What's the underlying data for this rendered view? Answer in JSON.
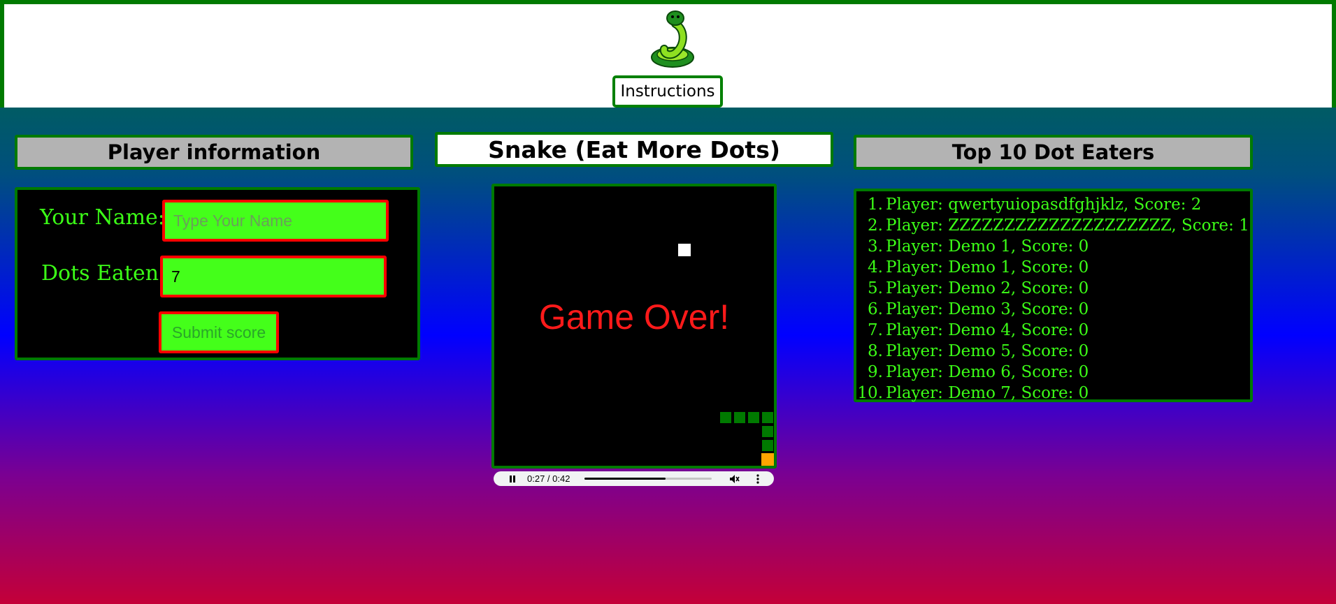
{
  "header": {
    "instructions_label": "Instructions"
  },
  "player_panel": {
    "title": "Player information",
    "name_label": "Your Name:",
    "name_value": "",
    "name_placeholder": "Type Your Name",
    "dots_label": "Dots Eaten:",
    "dots_value": "7",
    "submit_label": "Submit score"
  },
  "game_panel": {
    "title": "Snake (Eat More Dots)",
    "status_text": "Game Over!",
    "media": {
      "time": "0:27 / 0:42",
      "progress": 0.64
    }
  },
  "scores_panel": {
    "title": "Top 10 Dot Eaters",
    "entries": [
      {
        "rank": "1.",
        "text": "Player: qwertyuiopasdfghjklz, Score: 2"
      },
      {
        "rank": "2.",
        "text": "Player: ZZZZZZZZZZZZZZZZZZZZ, Score: 1"
      },
      {
        "rank": "3.",
        "text": "Player: Demo 1, Score: 0"
      },
      {
        "rank": "4.",
        "text": "Player: Demo 1, Score: 0"
      },
      {
        "rank": "5.",
        "text": "Player: Demo 2, Score: 0"
      },
      {
        "rank": "6.",
        "text": "Player: Demo 3, Score: 0"
      },
      {
        "rank": "7.",
        "text": "Player: Demo 4, Score: 0"
      },
      {
        "rank": "8.",
        "text": "Player: Demo 5, Score: 0"
      },
      {
        "rank": "9.",
        "text": "Player: Demo 6, Score: 0"
      },
      {
        "rank": "10.",
        "text": "Player: Demo 7, Score: 0"
      }
    ]
  },
  "colors": {
    "accent_green": "#007a00",
    "text_green": "#3cff17",
    "field_fill": "#44ff1a",
    "field_border": "#ff0000",
    "game_over_red": "#ff1a1a",
    "snake_head": "#ffa500"
  }
}
